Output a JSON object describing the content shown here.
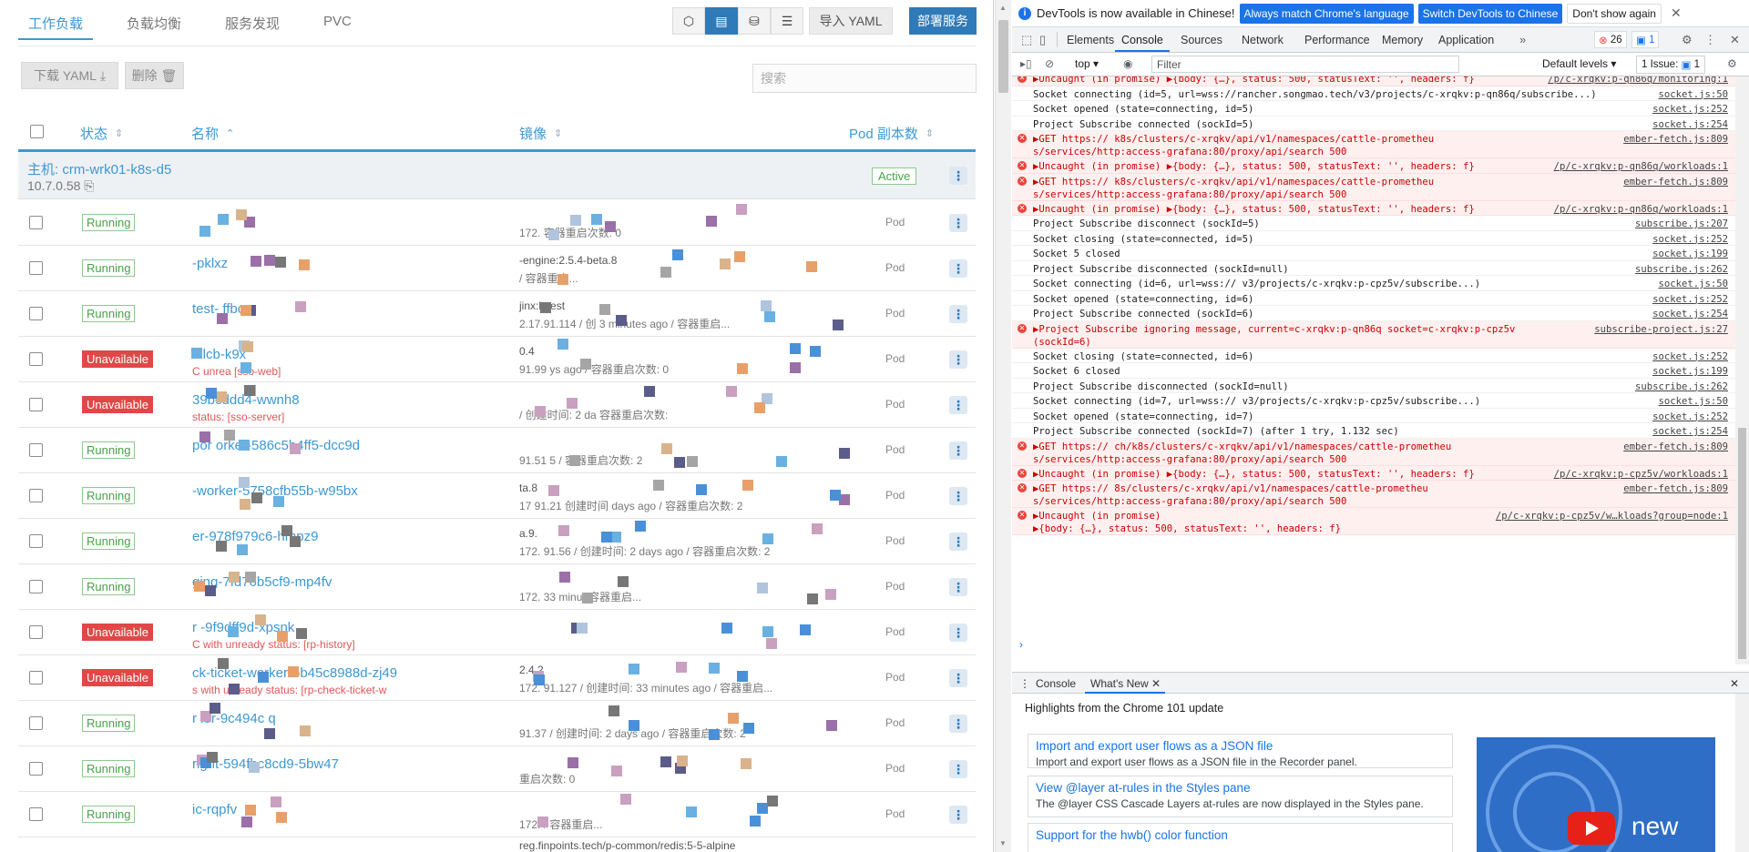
{
  "left": {
    "tabs": [
      "工作负载",
      "负载均衡",
      "服务发现",
      "PVC"
    ],
    "buttons": {
      "import": "导入 YAML",
      "deploy": "部署服务",
      "download": "下载 YAML",
      "delete": "删除"
    },
    "search_placeholder": "搜索",
    "headers": {
      "state": "状态",
      "name": "名称",
      "image": "镜像",
      "pods": "Pod 副本数"
    },
    "group": {
      "host_label": "主机:",
      "host_name": "crm-wrk01-k8s-d5",
      "ip": "10.7.0.58",
      "status": "Active"
    },
    "rows": [
      {
        "status": "Running",
        "ok": true,
        "name": "",
        "err": "",
        "image": "",
        "meta": "172.          容器重启次数: 0",
        "type": "Pod"
      },
      {
        "status": "Running",
        "ok": true,
        "name": "                -pklxz",
        "err": "",
        "image": "                 -engine:2.5.4-beta.8",
        "meta": "           / 容器重启...",
        "type": "Pod"
      },
      {
        "status": "Running",
        "ok": true,
        "name": "test-    ffbc",
        "err": "",
        "image": "                   jinx:latest",
        "meta": "2.17.91.114  / 创      3 minutes ago / 容器重启...",
        "type": "Pod"
      },
      {
        "status": "Unavailable",
        "ok": false,
        "name": "s           lcb-k9x",
        "err": "C       unrea      [sso-web]",
        "image": "                    0.4",
        "meta": "    91.99              ys ago / 容器重启次数: 0",
        "type": "Pod"
      },
      {
        "status": "Unavailable",
        "ok": false,
        "name": "        39bcddd4-wwnh8",
        "err": "            status: [sso-server]",
        "image": "",
        "meta": "          / 创建时间: 2 da     容器重启次数:",
        "type": "Pod"
      },
      {
        "status": "Running",
        "ok": true,
        "name": "          por   orker-586c5b4ff5-dcc9d",
        "err": "",
        "image": "",
        "meta": "    91.51              5 / 容器重启次数: 2",
        "type": "Pod"
      },
      {
        "status": "Running",
        "ok": true,
        "name": "        -worker-5758cfb55b-w95bx",
        "err": "",
        "image": "                        ta.8",
        "meta": "17   91.21   创建时间   days ago / 容器重启次数: 2",
        "type": "Pod"
      },
      {
        "status": "Running",
        "ok": true,
        "name": "       er-978f979c6-hmpz9",
        "err": "",
        "image": "                         a.9.",
        "meta": "172.    91.56   / 创建时间: 2 days ago / 容器重启次数: 2",
        "type": "Pod"
      },
      {
        "status": "Running",
        "ok": true,
        "name": "        ging-7fd76b5cf9-mp4fv",
        "err": "",
        "image": "",
        "meta": "172.           33 minut              容器重启...",
        "type": "Pod"
      },
      {
        "status": "Unavailable",
        "ok": false,
        "name": "r       -9f9dff9d-xpsnk",
        "err": "C      with unready status: [rp-history]",
        "image": "",
        "meta": "",
        "type": "Pod"
      },
      {
        "status": "Unavailable",
        "ok": false,
        "name": "       ck-ticket-worker-6b45c8988d-zj49",
        "err": "     s with unready status: [rp-check-ticket-w",
        "image": "                      2.4.2",
        "meta": "172.    91.127  / 创建时间: 33 minutes ago / 容器重启...",
        "type": "Pod"
      },
      {
        "status": "Running",
        "ok": true,
        "name": "r      ler-9c494c     q",
        "err": "",
        "image": "",
        "meta": "    91.37   / 创建时间: 2 days ago / 容器重启次数: 2",
        "type": "Pod"
      },
      {
        "status": "Running",
        "ok": true,
        "name": "        right-594fbc8cd9-5bw47",
        "err": "",
        "image": "",
        "meta": "                      重启次数: 0",
        "type": "Pod"
      },
      {
        "status": "Running",
        "ok": true,
        "name": "          ic-rqpfv",
        "err": "",
        "image": "",
        "meta": "172.                      / 容器重启...",
        "type": "Pod"
      }
    ],
    "footer_image": "reg.finpoints.tech/p-common/redis:5-5-alpine"
  },
  "devtools": {
    "infobar": {
      "text": "DevTools is now available in Chinese!",
      "btn1": "Always match Chrome's language",
      "btn2": "Switch DevTools to Chinese",
      "btn3": "Don't show again"
    },
    "tabs": [
      "Elements",
      "Console",
      "Sources",
      "Network",
      "Performance",
      "Memory",
      "Application"
    ],
    "error_count": "26",
    "message_count": "1",
    "context": "top",
    "filter_placeholder": "Filter",
    "levels": "Default levels",
    "issues": "1 Issue:",
    "issues_count": "1",
    "console": [
      {
        "err": true,
        "text": "▶Uncaught (in promise) ▶{body: {…}, status: 500, statusText: '', headers: f}",
        "src": "/p/c-xrqkv:p-qn86q/monitoring:1"
      },
      {
        "err": false,
        "text": "Socket connecting (id=5, url=wss://rancher.songmao.tech/v3/projects/c-xrqkv:p-qn86q/subscribe...)",
        "src": "socket.js:50"
      },
      {
        "err": false,
        "text": "Socket opened (state=connecting, id=5)",
        "src": "socket.js:252"
      },
      {
        "err": false,
        "text": "Project Subscribe connected (sockId=5)",
        "src": "socket.js:254"
      },
      {
        "err": true,
        "text": "▶GET https://              k8s/clusters/c-xrqkv/api/v1/namespaces/cattle-prometheu",
        "text2": "s/services/http:access-grafana:80/proxy/api/search 500",
        "src": "ember-fetch.js:809"
      },
      {
        "err": true,
        "text": "▶Uncaught (in promise) ▶{body: {…}, status: 500, statusText: '', headers: f}",
        "src": "/p/c-xrqkv:p-qn86q/workloads:1"
      },
      {
        "err": true,
        "text": "▶GET https://             k8s/clusters/c-xrqkv/api/v1/namespaces/cattle-prometheu",
        "text2": "s/services/http:access-grafana:80/proxy/api/search 500",
        "src": "ember-fetch.js:809"
      },
      {
        "err": true,
        "text": "▶Uncaught (in promise) ▶{body: {…}, status: 500, statusText: '', headers: f}",
        "src": "/p/c-xrqkv:p-qn86q/workloads:1"
      },
      {
        "err": false,
        "text": "Project Subscribe disconnect (sockId=5)",
        "src": "subscribe.js:207"
      },
      {
        "err": false,
        "text": "Socket closing (state=connected, id=5)",
        "src": "socket.js:252"
      },
      {
        "err": false,
        "text": "Socket 5 closed",
        "src": "socket.js:199"
      },
      {
        "err": false,
        "text": "Project Subscribe disconnected (sockId=null)",
        "src": "subscribe.js:262"
      },
      {
        "err": false,
        "text": "Socket connecting (id=6, url=wss://              v3/projects/c-xrqkv:p-cpz5v/subscribe...)",
        "src": "socket.js:50"
      },
      {
        "err": false,
        "text": "Socket opened (state=connecting, id=6)",
        "src": "socket.js:252"
      },
      {
        "err": false,
        "text": "Project Subscribe connected (sockId=6)",
        "src": "socket.js:254"
      },
      {
        "err": true,
        "text": "▶Project Subscribe ignoring message, current=c-xrqkv:p-qn86q socket=c-xrqkv:p-cpz5v",
        "text2": "(sockId=6)",
        "src": "subscribe-project.js:27"
      },
      {
        "err": false,
        "text": "Socket closing (state=connected, id=6)",
        "src": "socket.js:252"
      },
      {
        "err": false,
        "text": "Socket 6 closed",
        "src": "socket.js:199"
      },
      {
        "err": false,
        "text": "Project Subscribe disconnected (sockId=null)",
        "src": "subscribe.js:262"
      },
      {
        "err": false,
        "text": "Socket connecting (id=7, url=wss://              v3/projects/c-xrqkv:p-cpz5v/subscribe...)",
        "src": "socket.js:50"
      },
      {
        "err": false,
        "text": "Socket opened (state=connecting, id=7)",
        "src": "socket.js:252"
      },
      {
        "err": false,
        "text": "Project Subscribe connected (sockId=7) (after 1 try, 1.132 sec)",
        "src": "socket.js:254"
      },
      {
        "err": true,
        "text": "▶GET https://         ch/k8s/clusters/c-xrqkv/api/v1/namespaces/cattle-prometheu",
        "text2": "s/services/http:access-grafana:80/proxy/api/search 500",
        "src": "ember-fetch.js:809"
      },
      {
        "err": true,
        "text": "▶Uncaught (in promise) ▶{body: {…}, status: 500, statusText: '', headers: f}",
        "src": "/p/c-xrqkv:p-cpz5v/workloads:1"
      },
      {
        "err": true,
        "text": "▶GET https://          8s/clusters/c-xrqkv/api/v1/namespaces/cattle-prometheu",
        "text2": "s/services/http:access-grafana:80/proxy/api/search 500",
        "src": "ember-fetch.js:809"
      },
      {
        "err": true,
        "text": "▶Uncaught (in promise)",
        "text2": "▶{body: {…}, status: 500, statusText: '', headers: f}",
        "src": "/p/c-xrqkv:p-cpz5v/w…kloads?group=node:1"
      }
    ],
    "drawer": {
      "tabs": [
        "Console",
        "What's New"
      ],
      "title": "Highlights from the Chrome 101 update",
      "cards": [
        {
          "title": "Import and export user flows as a JSON file",
          "desc": "Import and export user flows as a JSON file in the Recorder panel."
        },
        {
          "title": "View @layer at-rules in the Styles pane",
          "desc": "The @layer CSS Cascade Layers at-rules are now displayed in the Styles pane."
        },
        {
          "title": "Support for the hwb() color function",
          "desc": ""
        }
      ],
      "video_text": "new"
    }
  }
}
